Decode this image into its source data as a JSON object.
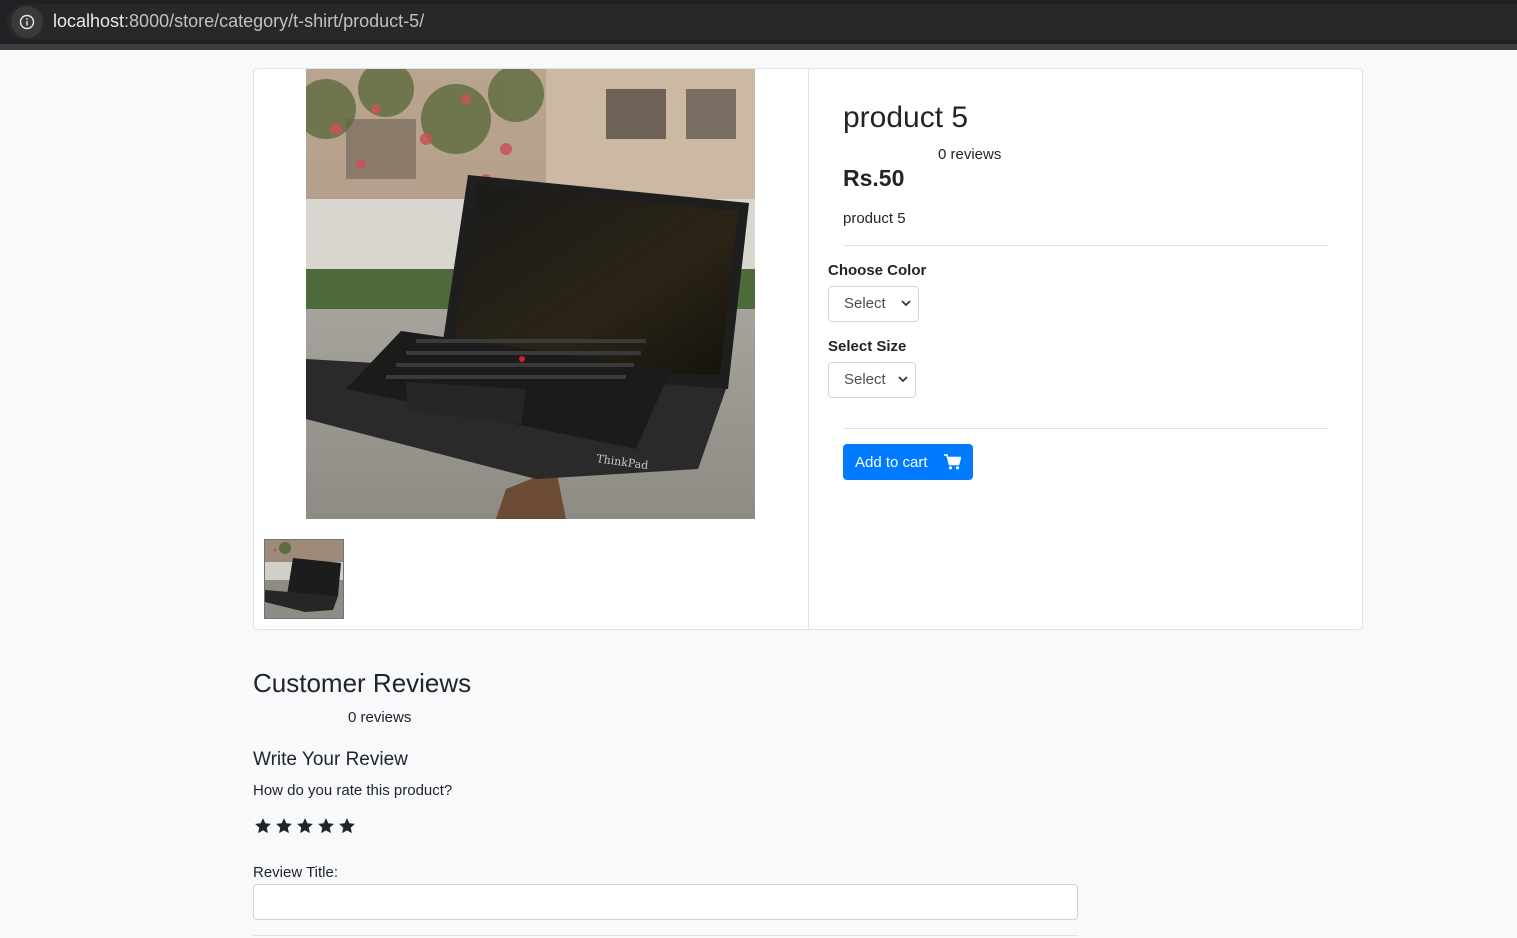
{
  "browser": {
    "url_host": "localhost",
    "url_path": ":8000/store/category/t-shirt/product-5/"
  },
  "product": {
    "title": "product 5",
    "reviews": "0 reviews",
    "price": "Rs.50",
    "description": "product 5",
    "color_label": "Choose Color",
    "color_selected": "Select",
    "size_label": "Select Size",
    "size_selected": "Select",
    "add_to_cart": "Add to cart",
    "image_subject": "laptop-photo"
  },
  "reviews_section": {
    "heading": "Customer Reviews",
    "count": "0 reviews",
    "write_heading": "Write Your Review",
    "rate_question": "How do you rate this product?",
    "stars": 5,
    "title_label": "Review Title:",
    "title_value": ""
  },
  "colors": {
    "primary": "#007bff",
    "text": "#212529",
    "page_bg": "#f8f9fa"
  }
}
